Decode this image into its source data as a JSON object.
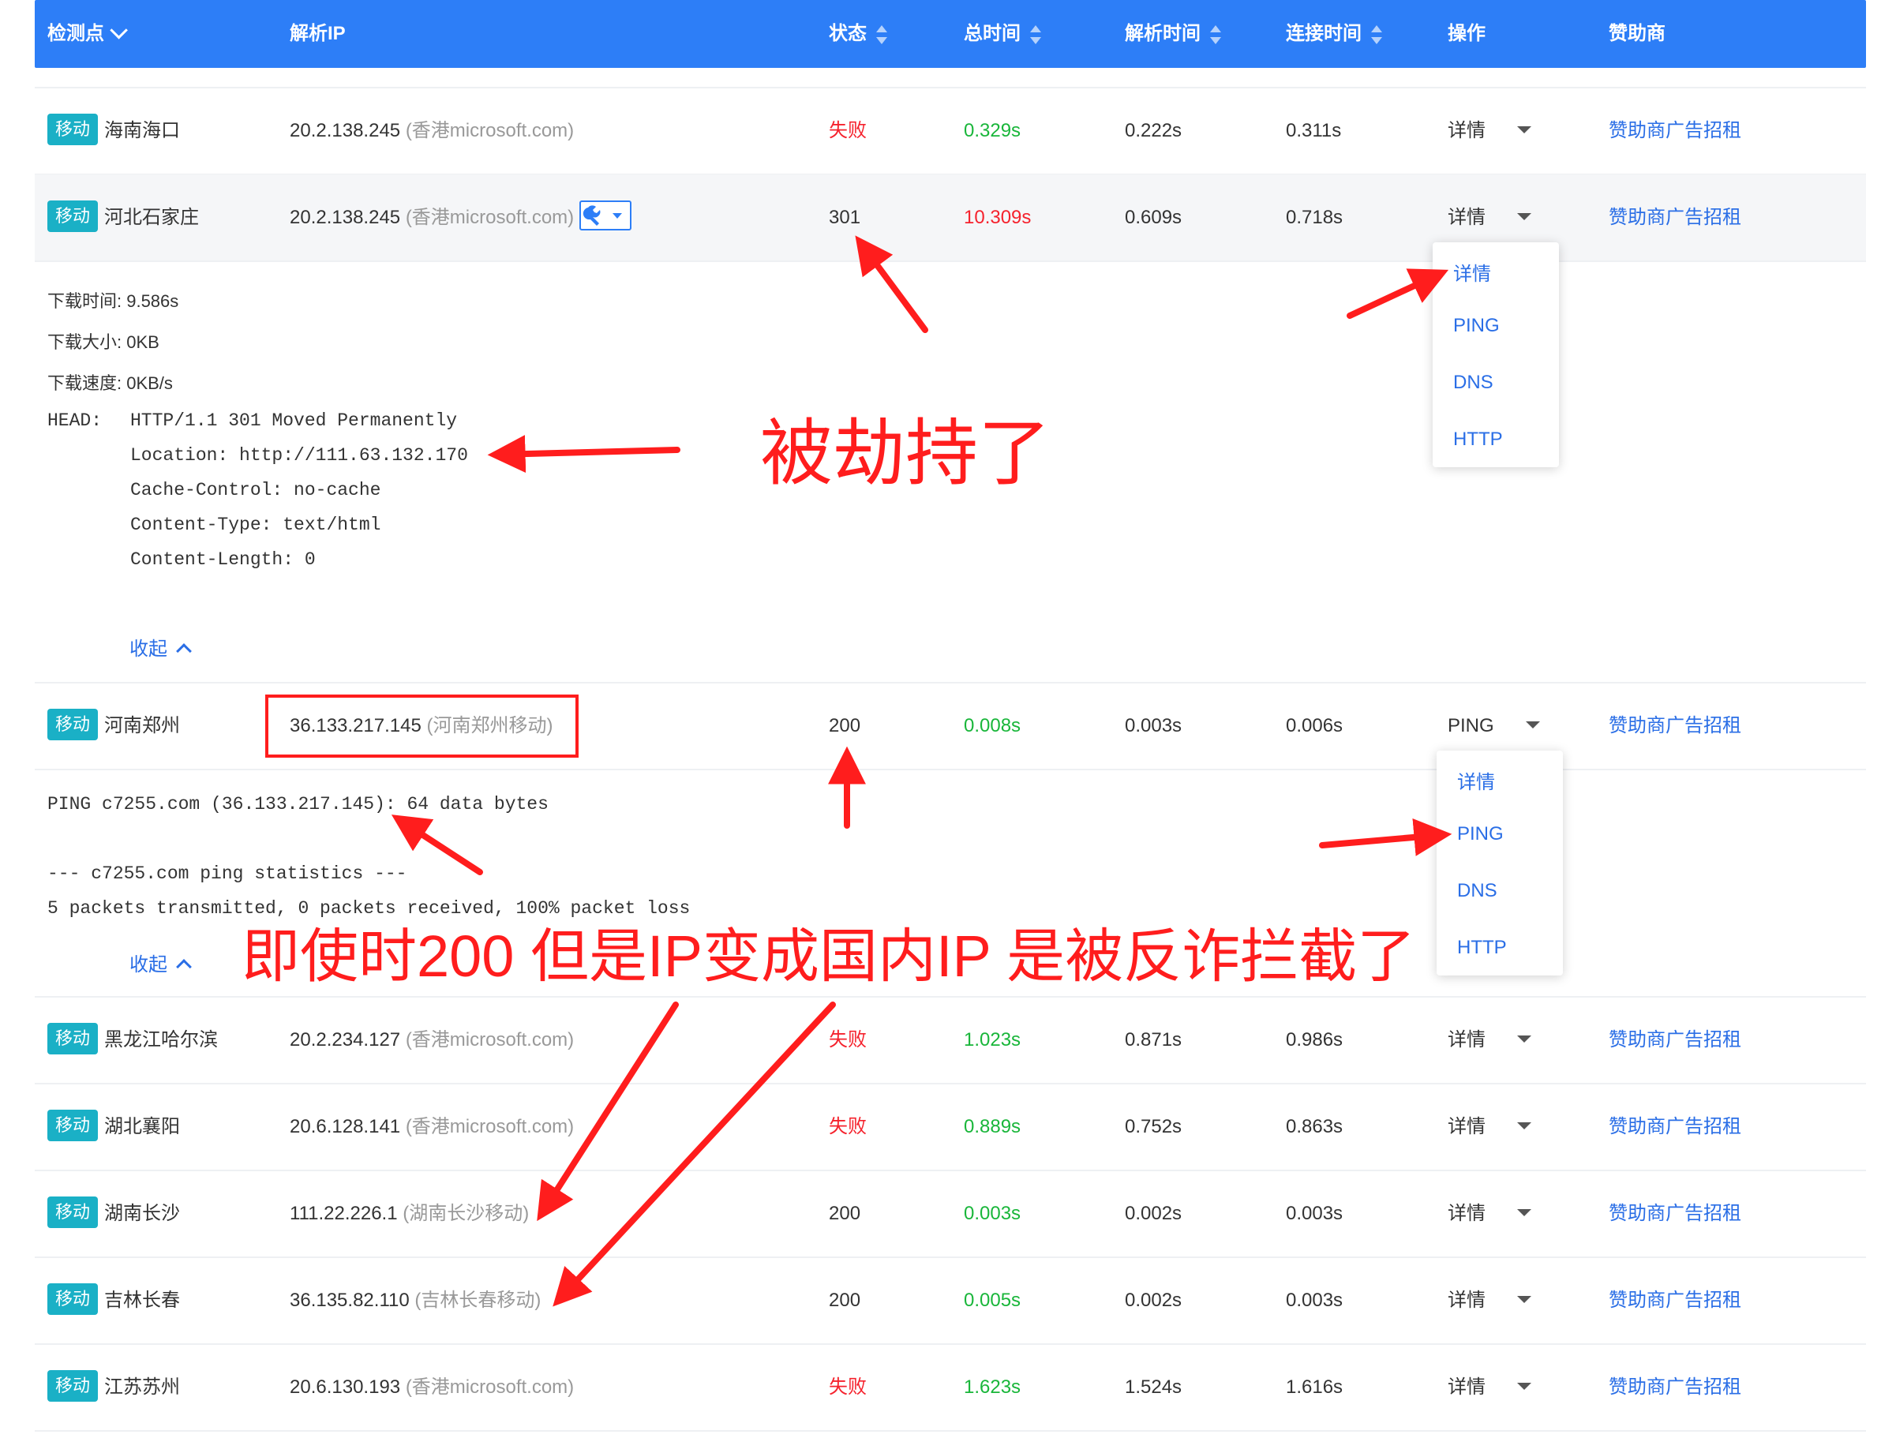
{
  "header": {
    "col_checkpoint": "检测点",
    "col_ip": "解析IP",
    "col_status": "状态",
    "col_total": "总时间",
    "col_resolve": "解析时间",
    "col_connect": "连接时间",
    "col_action": "操作",
    "col_sponsor": "赞助商"
  },
  "rows": [
    {
      "isp": "移动",
      "location": "海南海口",
      "ip": "20.2.138.245",
      "ip_note": "(香港microsoft.com)",
      "status": "失败",
      "total": "0.329s",
      "resolve": "0.222s",
      "connect": "0.311s",
      "action": "详情",
      "sponsor": "赞助商广告招租"
    },
    {
      "isp": "移动",
      "location": "河北石家庄",
      "ip": "20.2.138.245",
      "ip_note": "(香港microsoft.com)",
      "status": "301",
      "total": "10.309s",
      "resolve": "0.609s",
      "connect": "0.718s",
      "action": "详情",
      "sponsor": "赞助商广告招租"
    },
    {
      "isp": "移动",
      "location": "河南郑州",
      "ip": "36.133.217.145",
      "ip_note": "(河南郑州移动)",
      "status": "200",
      "total": "0.008s",
      "resolve": "0.003s",
      "connect": "0.006s",
      "action": "PING",
      "sponsor": "赞助商广告招租"
    },
    {
      "isp": "移动",
      "location": "黑龙江哈尔滨",
      "ip": "20.2.234.127",
      "ip_note": "(香港microsoft.com)",
      "status": "失败",
      "total": "1.023s",
      "resolve": "0.871s",
      "connect": "0.986s",
      "action": "详情",
      "sponsor": "赞助商广告招租"
    },
    {
      "isp": "移动",
      "location": "湖北襄阳",
      "ip": "20.6.128.141",
      "ip_note": "(香港microsoft.com)",
      "status": "失败",
      "total": "0.889s",
      "resolve": "0.752s",
      "connect": "0.863s",
      "action": "详情",
      "sponsor": "赞助商广告招租"
    },
    {
      "isp": "移动",
      "location": "湖南长沙",
      "ip": "111.22.226.1",
      "ip_note": "(湖南长沙移动)",
      "status": "200",
      "total": "0.003s",
      "resolve": "0.002s",
      "connect": "0.003s",
      "action": "详情",
      "sponsor": "赞助商广告招租"
    },
    {
      "isp": "移动",
      "location": "吉林长春",
      "ip": "36.135.82.110",
      "ip_note": "(吉林长春移动)",
      "status": "200",
      "total": "0.005s",
      "resolve": "0.002s",
      "connect": "0.003s",
      "action": "详情",
      "sponsor": "赞助商广告招租"
    },
    {
      "isp": "移动",
      "location": "江苏苏州",
      "ip": "20.6.130.193",
      "ip_note": "(香港microsoft.com)",
      "status": "失败",
      "total": "1.623s",
      "resolve": "1.524s",
      "connect": "1.616s",
      "action": "详情",
      "sponsor": "赞助商广告招租"
    }
  ],
  "detail_http": {
    "download_time": "下载时间: 9.586s",
    "download_size": "下载大小: 0KB",
    "download_speed": "下载速度: 0KB/s",
    "head_label": "HEAD:",
    "head_lines": [
      "HTTP/1.1 301 Moved Permanently",
      "Location: http://111.63.132.170",
      "Cache-Control: no-cache",
      "Content-Type: text/html",
      "Content-Length: 0"
    ],
    "collapse": "收起"
  },
  "detail_ping": {
    "lines": [
      "PING c7255.com (36.133.217.145): 64 data bytes",
      "--- c7255.com ping statistics ---",
      "5 packets transmitted, 0 packets received, 100% packet loss"
    ],
    "collapse": "收起"
  },
  "dropdown": {
    "items": [
      "详情",
      "PING",
      "DNS",
      "HTTP"
    ]
  },
  "annotations": {
    "hijacked": "被劫持了",
    "anti_fraud": "即使时200 但是IP变成国内IP 是被反诈拦截了"
  },
  "colors": {
    "header_blue": "#2d7ef7",
    "isp_tag": "#1ab0c6",
    "fail_red": "#f5222d",
    "time_green": "#19b63a",
    "link_blue": "#2a6ee6",
    "annotation_red": "#ff1d1d"
  }
}
